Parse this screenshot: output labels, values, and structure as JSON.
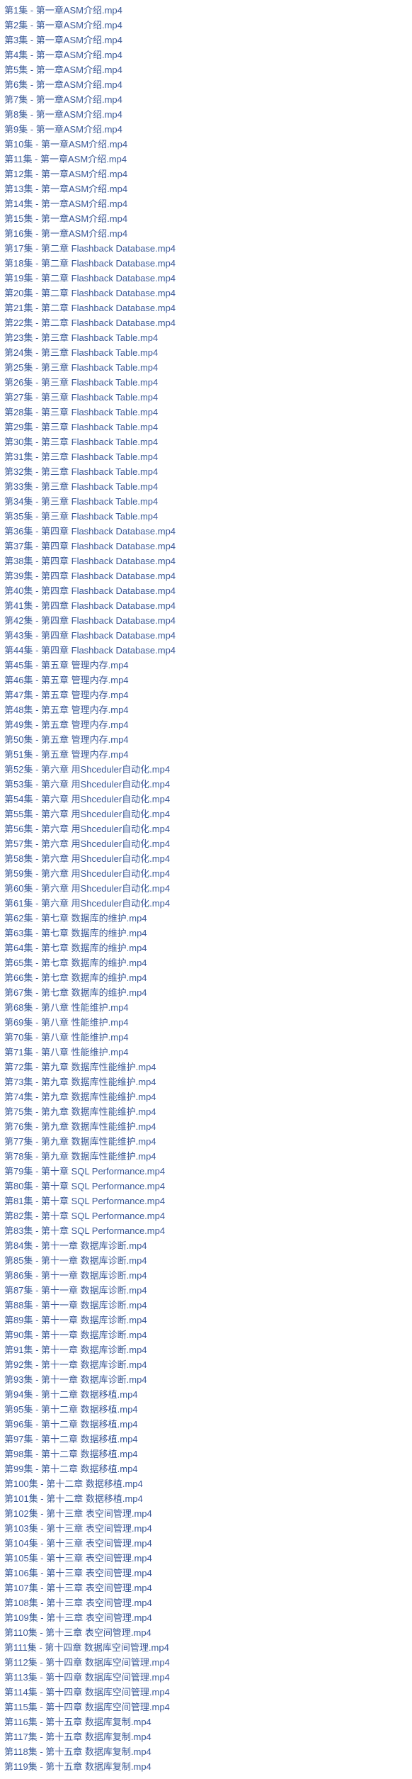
{
  "files": [
    "第1集 - 第一章ASM介绍.mp4",
    "第2集 - 第一章ASM介绍.mp4",
    "第3集 - 第一章ASM介绍.mp4",
    "第4集 - 第一章ASM介绍.mp4",
    "第5集 - 第一章ASM介绍.mp4",
    "第6集 - 第一章ASM介绍.mp4",
    "第7集 - 第一章ASM介绍.mp4",
    "第8集 - 第一章ASM介绍.mp4",
    "第9集 - 第一章ASM介绍.mp4",
    "第10集 - 第一章ASM介绍.mp4",
    "第11集 - 第一章ASM介绍.mp4",
    "第12集 - 第一章ASM介绍.mp4",
    "第13集 - 第一章ASM介绍.mp4",
    "第14集 - 第一章ASM介绍.mp4",
    "第15集 - 第一章ASM介绍.mp4",
    "第16集 - 第一章ASM介绍.mp4",
    "第17集 - 第二章 Flashback Database.mp4",
    "第18集 - 第二章 Flashback Database.mp4",
    "第19集 - 第二章 Flashback Database.mp4",
    "第20集 - 第二章 Flashback Database.mp4",
    "第21集 - 第二章 Flashback Database.mp4",
    "第22集 - 第二章 Flashback Database.mp4",
    "第23集 - 第三章 Flashback Table.mp4",
    "第24集 - 第三章 Flashback Table.mp4",
    "第25集 - 第三章 Flashback Table.mp4",
    "第26集 - 第三章 Flashback Table.mp4",
    "第27集 - 第三章 Flashback Table.mp4",
    "第28集 - 第三章 Flashback Table.mp4",
    "第29集 - 第三章 Flashback Table.mp4",
    "第30集 - 第三章 Flashback Table.mp4",
    "第31集 - 第三章 Flashback Table.mp4",
    "第32集 - 第三章 Flashback Table.mp4",
    "第33集 - 第三章 Flashback Table.mp4",
    "第34集 - 第三章 Flashback Table.mp4",
    "第35集 - 第三章 Flashback Table.mp4",
    "第36集 - 第四章 Flashback Database.mp4",
    "第37集 - 第四章 Flashback Database.mp4",
    "第38集 - 第四章 Flashback Database.mp4",
    "第39集 - 第四章 Flashback Database.mp4",
    "第40集 - 第四章 Flashback Database.mp4",
    "第41集 - 第四章 Flashback Database.mp4",
    "第42集 - 第四章 Flashback Database.mp4",
    "第43集 - 第四章 Flashback Database.mp4",
    "第44集 - 第四章 Flashback Database.mp4",
    "第45集 - 第五章 管理内存.mp4",
    "第46集 - 第五章 管理内存.mp4",
    "第47集 - 第五章 管理内存.mp4",
    "第48集 - 第五章 管理内存.mp4",
    "第49集 - 第五章 管理内存.mp4",
    "第50集 - 第五章 管理内存.mp4",
    "第51集 - 第五章 管理内存.mp4",
    "第52集 - 第六章 用Shceduler自动化.mp4",
    "第53集 - 第六章 用Shceduler自动化.mp4",
    "第54集 - 第六章 用Shceduler自动化.mp4",
    "第55集 - 第六章 用Shceduler自动化.mp4",
    "第56集 - 第六章 用Shceduler自动化.mp4",
    "第57集 - 第六章 用Shceduler自动化.mp4",
    "第58集 - 第六章 用Shceduler自动化.mp4",
    "第59集 - 第六章 用Shceduler自动化.mp4",
    "第60集 - 第六章 用Shceduler自动化.mp4",
    "第61集 - 第六章 用Shceduler自动化.mp4",
    "第62集 - 第七章 数据库的维护.mp4",
    "第63集 - 第七章 数据库的维护.mp4",
    "第64集 - 第七章 数据库的维护.mp4",
    "第65集 - 第七章 数据库的维护.mp4",
    "第66集 - 第七章 数据库的维护.mp4",
    "第67集 - 第七章 数据库的维护.mp4",
    "第68集 - 第八章 性能维护.mp4",
    "第69集 - 第八章 性能维护.mp4",
    "第70集 - 第八章 性能维护.mp4",
    "第71集 - 第八章 性能维护.mp4",
    "第72集 - 第九章 数据库性能维护.mp4",
    "第73集 - 第九章 数据库性能维护.mp4",
    "第74集 - 第九章 数据库性能维护.mp4",
    "第75集 - 第九章 数据库性能维护.mp4",
    "第76集 - 第九章 数据库性能维护.mp4",
    "第77集 - 第九章 数据库性能维护.mp4",
    "第78集 - 第九章 数据库性能维护.mp4",
    "第79集 - 第十章 SQL Performance.mp4",
    "第80集 - 第十章 SQL Performance.mp4",
    "第81集 - 第十章 SQL Performance.mp4",
    "第82集 - 第十章 SQL Performance.mp4",
    "第83集 - 第十章 SQL Performance.mp4",
    "第84集 - 第十一章 数据库诊断.mp4",
    "第85集 - 第十一章 数据库诊断.mp4",
    "第86集 - 第十一章 数据库诊断.mp4",
    "第87集 - 第十一章 数据库诊断.mp4",
    "第88集 - 第十一章 数据库诊断.mp4",
    "第89集 - 第十一章 数据库诊断.mp4",
    "第90集 - 第十一章 数据库诊断.mp4",
    "第91集 - 第十一章 数据库诊断.mp4",
    "第92集 - 第十一章 数据库诊断.mp4",
    "第93集 - 第十一章 数据库诊断.mp4",
    "第94集 - 第十二章 数据移植.mp4",
    "第95集 - 第十二章 数据移植.mp4",
    "第96集 - 第十二章 数据移植.mp4",
    "第97集 - 第十二章 数据移植.mp4",
    "第98集 - 第十二章 数据移植.mp4",
    "第99集 - 第十二章 数据移植.mp4",
    "第100集 - 第十二章 数据移植.mp4",
    "第101集 - 第十二章 数据移植.mp4",
    "第102集 - 第十三章 表空间管理.mp4",
    "第103集 - 第十三章 表空间管理.mp4",
    "第104集 - 第十三章 表空间管理.mp4",
    "第105集 - 第十三章 表空间管理.mp4",
    "第106集 - 第十三章 表空间管理.mp4",
    "第107集 - 第十三章 表空间管理.mp4",
    "第108集 - 第十三章 表空间管理.mp4",
    "第109集 - 第十三章 表空间管理.mp4",
    "第110集 - 第十三章 表空间管理.mp4",
    "第111集 - 第十四章 数据库空间管理.mp4",
    "第112集 - 第十四章 数据库空间管理.mp4",
    "第113集 - 第十四章 数据库空间管理.mp4",
    "第114集 - 第十四章 数据库空间管理.mp4",
    "第115集 - 第十四章 数据库空间管理.mp4",
    "第116集 - 第十五章 数据库复制.mp4",
    "第117集 - 第十五章 数据库复制.mp4",
    "第118集 - 第十五章 数据库复制.mp4",
    "第119集 - 第十五章 数据库复制.mp4"
  ]
}
